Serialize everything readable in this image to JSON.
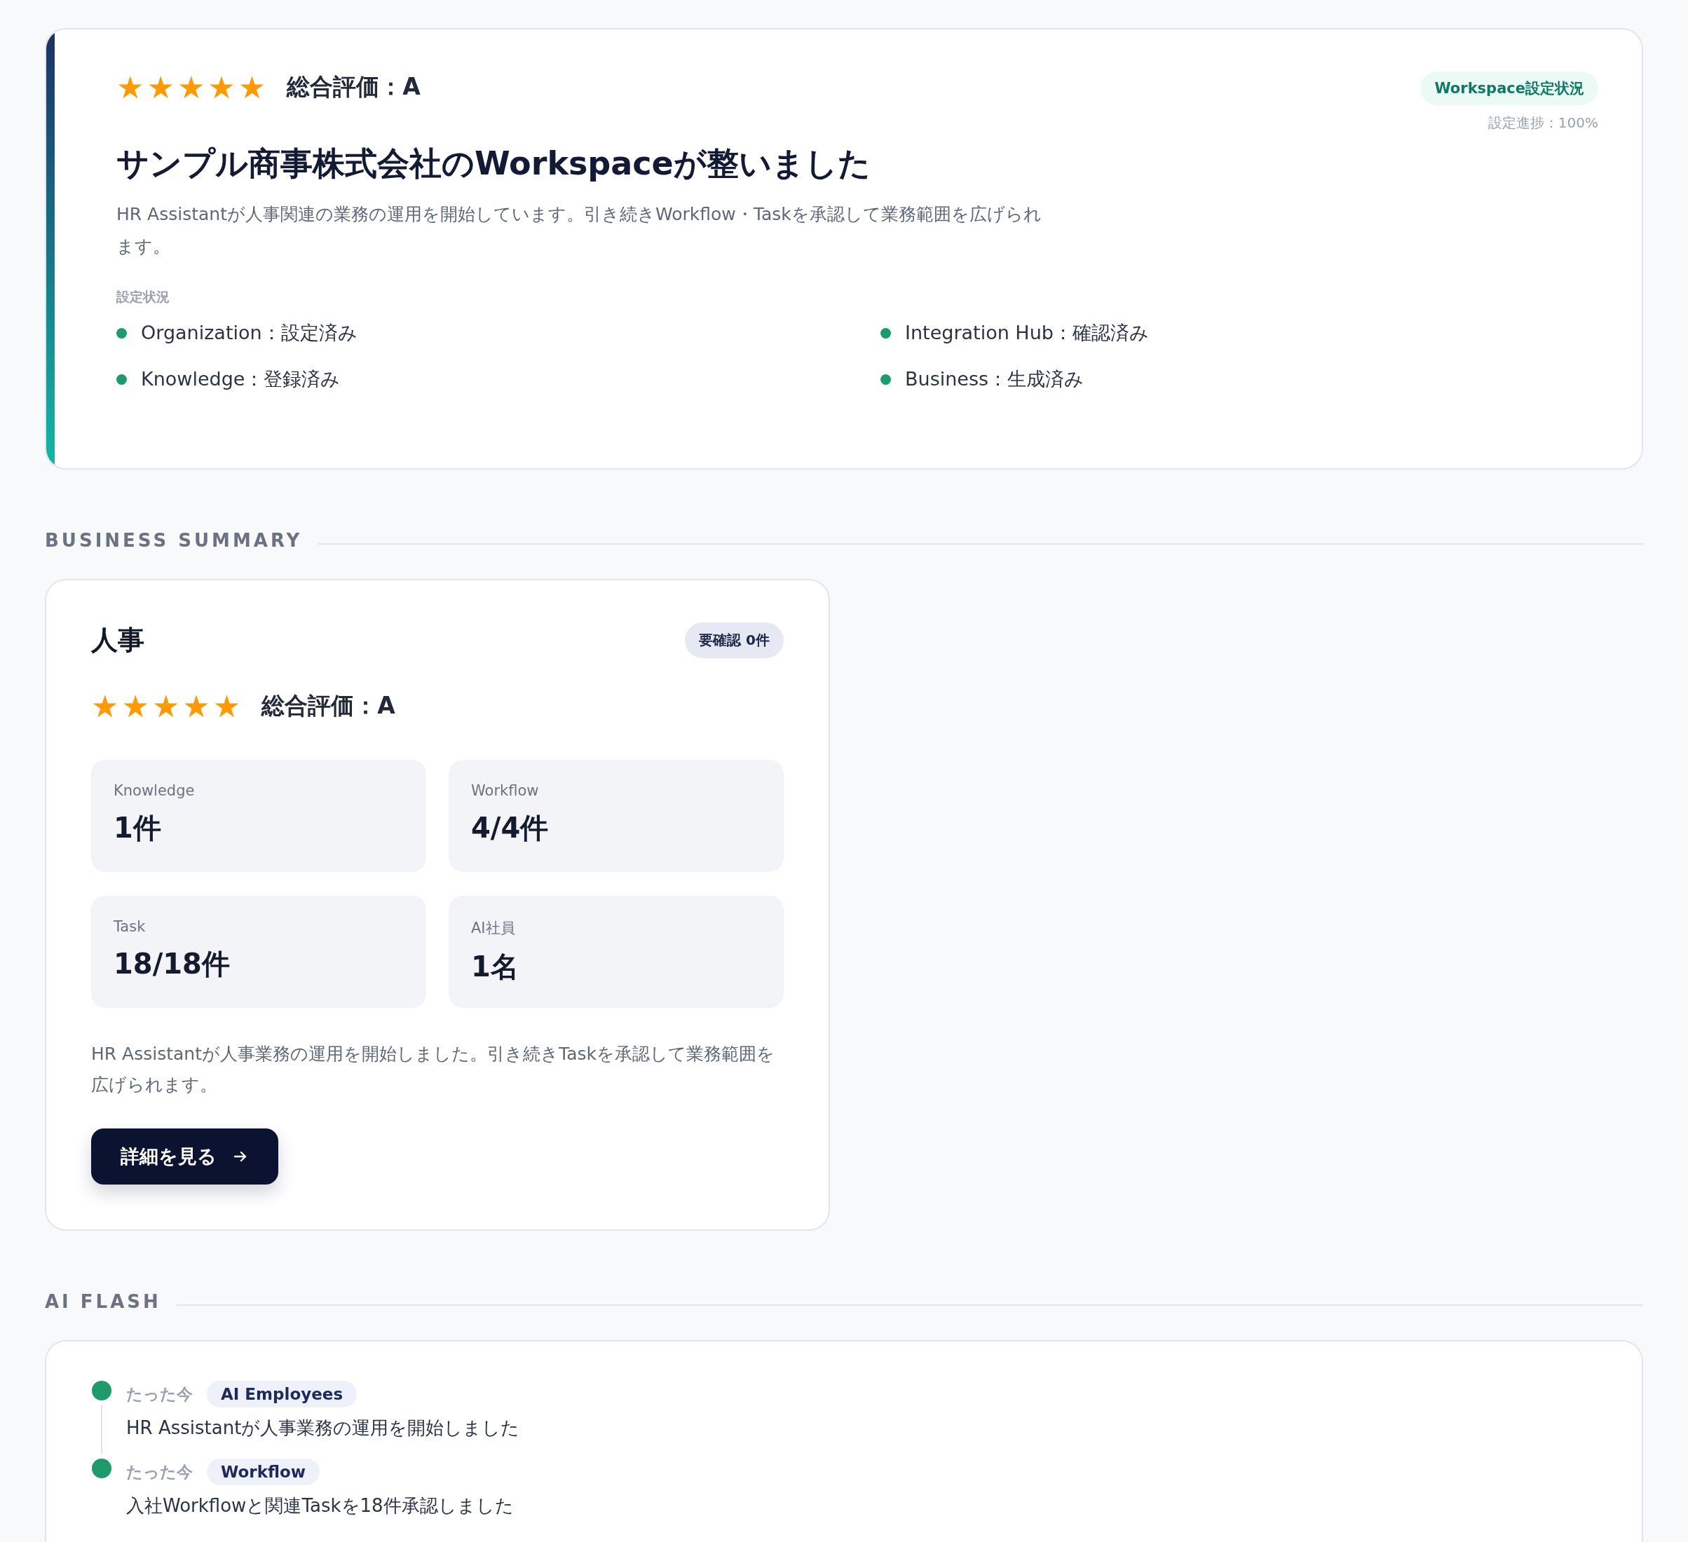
{
  "overview": {
    "stars": 5,
    "rating": "総合評価：A",
    "badge": "Workspace設定状況",
    "progress": "設定進捗：100%",
    "title": "サンプル商事株式会社のWorkspaceが整いました",
    "description": "HR Assistantが人事関連の業務の運用を開始しています。引き続きWorkflow・Taskを承認して業務範囲を広げられます。",
    "status_label": "設定状況",
    "status_items": [
      {
        "text": "Organization：設定済み"
      },
      {
        "text": "Integration Hub：確認済み"
      },
      {
        "text": "Knowledge：登録済み"
      },
      {
        "text": "Business：生成済み"
      }
    ]
  },
  "business_summary": {
    "heading": "BUSINESS SUMMARY",
    "cards": [
      {
        "title": "人事",
        "badge": "要確認 0件",
        "stars": 5,
        "rating": "総合評価：A",
        "stats": [
          {
            "label": "Knowledge",
            "value": "1件"
          },
          {
            "label": "Workflow",
            "value": "4/4件"
          },
          {
            "label": "Task",
            "value": "18/18件"
          },
          {
            "label": "AI社員",
            "value": "1名"
          }
        ],
        "description": "HR Assistantが人事業務の運用を開始しました。引き続きTaskを承認して業務範囲を広げられます。",
        "button": "詳細を見る"
      }
    ]
  },
  "ai_flash": {
    "heading": "AI FLASH",
    "items": [
      {
        "time": "たった今",
        "tag": "AI Employees",
        "message": "HR Assistantが人事業務の運用を開始しました"
      },
      {
        "time": "たった今",
        "tag": "Workflow",
        "message": "入社Workflowと関連Taskを18件承認しました"
      }
    ]
  }
}
